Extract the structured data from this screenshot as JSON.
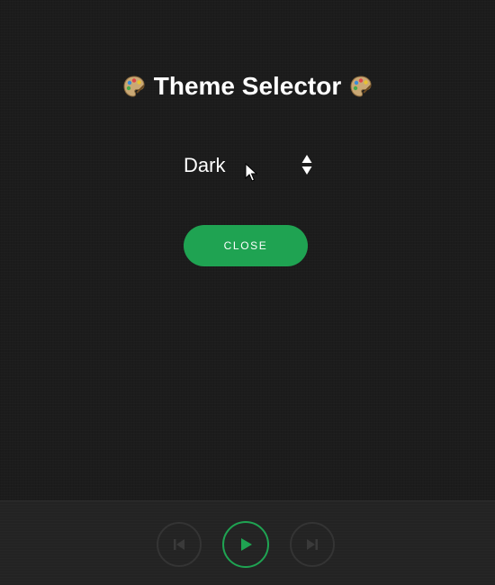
{
  "dialog": {
    "title": "Theme Selector",
    "title_icon_left": "palette-icon",
    "title_icon_right": "palette-icon",
    "theme_select": {
      "selected_value": "Dark",
      "icon": "up-down-arrows-icon"
    },
    "close_button_label": "CLOSE"
  },
  "player": {
    "previous_icon": "skip-previous-icon",
    "play_icon": "play-icon",
    "next_icon": "skip-next-icon"
  },
  "colors": {
    "background": "#1c1c1c",
    "accent_green": "#1fa352",
    "text": "#ffffff",
    "disabled_control": "#343434"
  }
}
